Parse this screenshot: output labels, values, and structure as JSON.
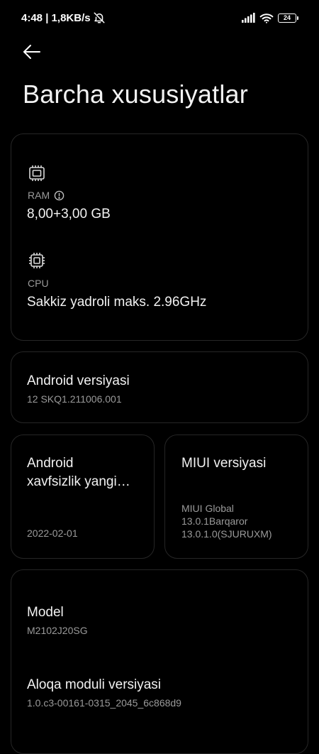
{
  "status_bar": {
    "time_speed": "4:48 | 1,8KB/s",
    "battery_level": "24",
    "icons": [
      "alarm-off-icon",
      "signal-icon",
      "wifi-icon",
      "battery-icon"
    ]
  },
  "header": {
    "back_icon": "back-arrow-icon",
    "title": "Barcha xususiyatlar"
  },
  "hardware": {
    "ram": {
      "icon": "memory-chip-icon",
      "label": "RAM",
      "value": "8,00+3,00 GB",
      "info_icon": "info-icon"
    },
    "cpu": {
      "icon": "processor-chip-icon",
      "label": "CPU",
      "value": "Sakkiz yadroli maks. 2.96GHz"
    }
  },
  "android_version": {
    "label": "Android versiyasi",
    "value": "12 SKQ1.211006.001"
  },
  "security_update": {
    "label_line1": "Android",
    "label_line2": "xavfsizlik yangi…",
    "value": "2022-02-01"
  },
  "miui_version": {
    "label": "MIUI versiyasi",
    "line1": "MIUI Global",
    "line2": "13.0.1Barqaror",
    "line3": "13.0.1.0(SJURUXM)"
  },
  "model": {
    "label": "Model",
    "value": "M2102J20SG"
  },
  "baseband": {
    "label": "Aloqa moduli versiyasi",
    "value": "1.0.c3-00161-0315_2045_6c868d9"
  },
  "colors": {
    "background": "#000000",
    "card_border": "#262626",
    "primary_text": "#f2f2f2",
    "secondary_text": "#9a9a9a"
  }
}
